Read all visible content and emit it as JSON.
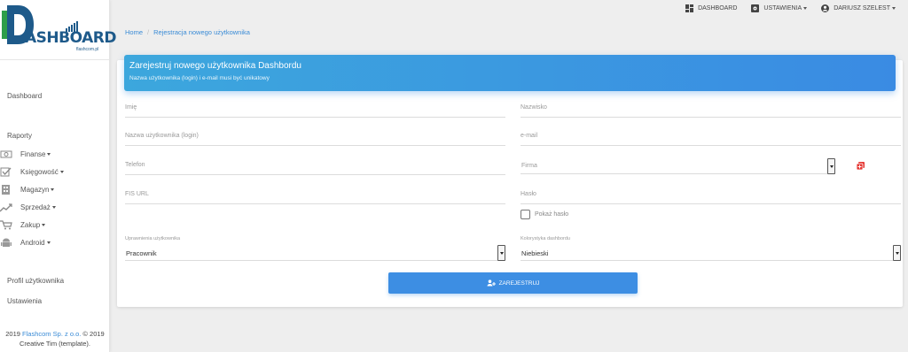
{
  "logo": {
    "wordmark": "ASHBOARD",
    "tagline": "flashcom.pl"
  },
  "sidebar": {
    "dashboard": "Dashboard",
    "reports": "Raporty",
    "submenu": [
      {
        "label": "Finanse",
        "icon": "money-icon"
      },
      {
        "label": "Księgowość",
        "icon": "checkbox-icon"
      },
      {
        "label": "Magazyn",
        "icon": "warehouse-icon"
      },
      {
        "label": "Sprzedaż",
        "icon": "trend-icon"
      },
      {
        "label": "Zakup",
        "icon": "cart-icon"
      },
      {
        "label": "Android",
        "icon": "android-icon"
      }
    ],
    "profile": "Profil użytkownika",
    "settings": "Ustawienia"
  },
  "footer": {
    "year": "2019",
    "company": "Flashcom Sp. z o.o.",
    "copy": "© 2019",
    "credit": "Creative Tim (template)."
  },
  "topnav": {
    "dashboard": "DASHBOARD",
    "settings": "USTAWIENIA",
    "user": "DARIUSZ SZELEST"
  },
  "breadcrumb": {
    "home": "Home",
    "separator": "/",
    "current": "Rejestracja nowego użytkownika"
  },
  "form": {
    "title": "Zarejestruj nowego użytkownika Dashbordu",
    "subtitle": "Nazwa użytkownika (login) i e-mail musi być unikatowy",
    "first_name": "Imię",
    "last_name": "Nazwisko",
    "username": "Nazwa użytkownika (login)",
    "email": "e-mail",
    "phone": "Telefon",
    "company": "Firma",
    "fis_url": "FIS URL",
    "password": "Hasło",
    "show_password": "Pokaż hasło",
    "permissions_label": "Uprawnienia użytkownika",
    "permissions_value": "Pracownik",
    "color_label": "Kolorystyka dashbordu",
    "color_value": "Niebieski",
    "submit": "ZAREJESTRUJ"
  },
  "colors": {
    "accent": "#3d8ee3",
    "header_start": "#3ca7dd",
    "brand": "#1e5a8a",
    "add_icon": "#e53935"
  }
}
